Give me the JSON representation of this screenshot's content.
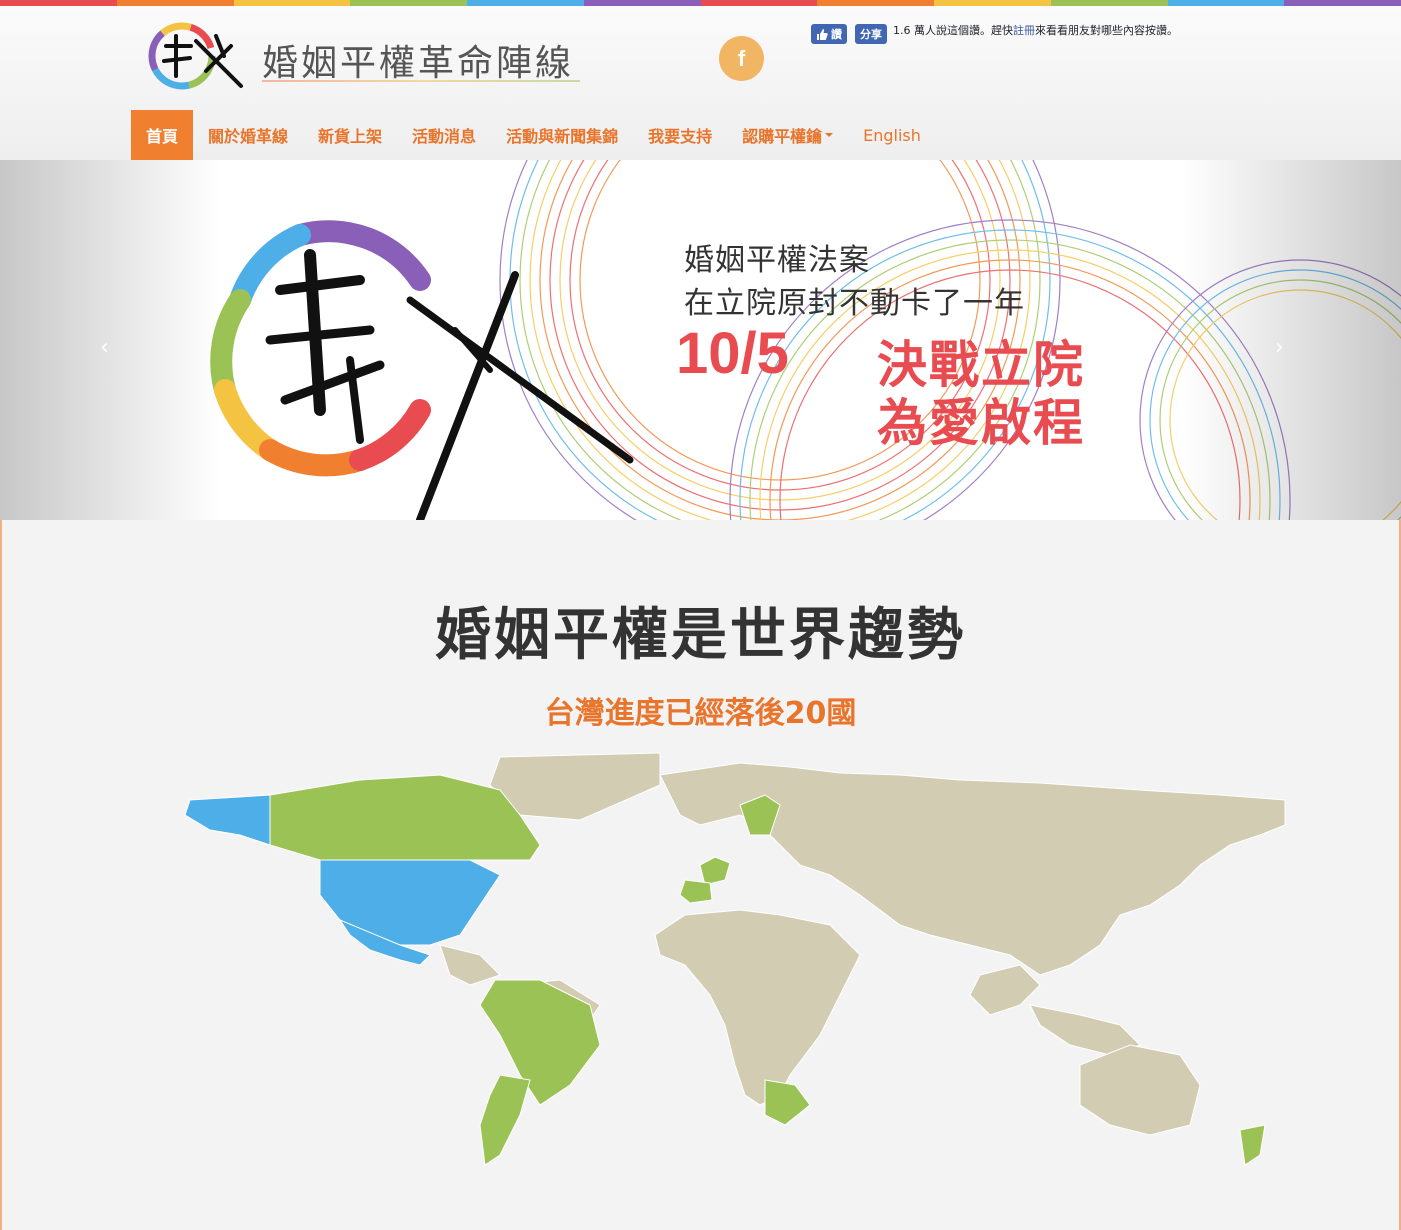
{
  "colors": {
    "accent": "#f08030",
    "nav_text": "#e8752b",
    "banner_red": "#e84c50",
    "map_land": "#d1ccb2",
    "map_green": "#9bc254",
    "map_blue": "#4daee8",
    "rainbow": [
      "#e84c50",
      "#f08030",
      "#f5c342",
      "#9bc254",
      "#4daee8",
      "#8a5fb8",
      "#e84c50",
      "#f08030",
      "#f5c342",
      "#9bc254",
      "#4daee8",
      "#8a5fb8"
    ]
  },
  "header": {
    "site_title": "婚姻平權革命陣線",
    "facebook_icon": "facebook-icon",
    "facebook_letter": "f",
    "fb_widget": {
      "like_label": "讚",
      "share_label": "分享",
      "text_before": "1.6 萬人說這個讚。趕快",
      "link_text": "註冊",
      "text_after": "來看看朋友對哪些內容按讚。"
    }
  },
  "nav": {
    "items": [
      {
        "label": "首頁"
      },
      {
        "label": "關於婚革線"
      },
      {
        "label": "新貨上架"
      },
      {
        "label": "活動消息"
      },
      {
        "label": "活動與新聞集錦"
      },
      {
        "label": "我要支持"
      },
      {
        "label": "認購平權鑰"
      },
      {
        "label": "English"
      }
    ]
  },
  "carousel": {
    "prev_arrow": "‹",
    "next_arrow": "›",
    "line1": "婚姻平權法案",
    "line2": "在立院原封不動卡了一年",
    "date": "10/5",
    "slogan1": "決戰立院",
    "slogan2": "為愛啟程"
  },
  "main": {
    "heading": "婚姻平權是世界趨勢",
    "subheading": "台灣進度已經落後20國"
  }
}
